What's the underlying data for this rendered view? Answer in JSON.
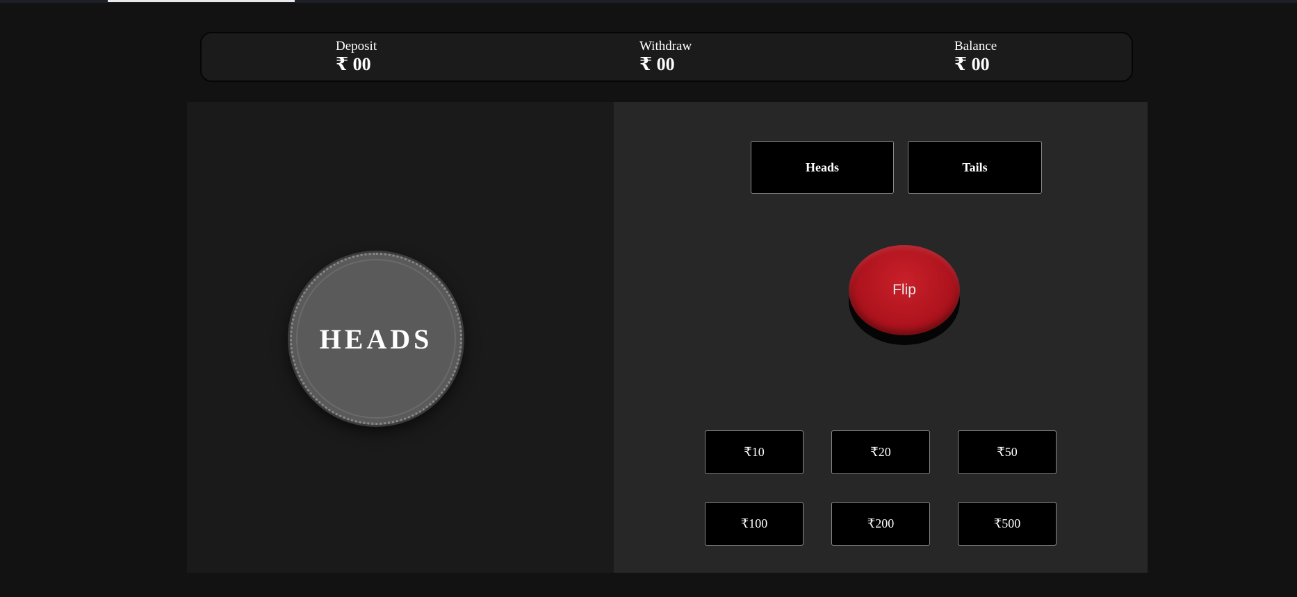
{
  "stats": {
    "deposit": {
      "label": "Deposit",
      "value": "₹ 00"
    },
    "withdraw": {
      "label": "Withdraw",
      "value": "₹ 00"
    },
    "balance": {
      "label": "Balance",
      "value": "₹ 00"
    }
  },
  "coin": {
    "face": "HEADS"
  },
  "choices": {
    "heads_label": "Heads",
    "tails_label": "Tails"
  },
  "flip": {
    "label": "Flip",
    "color": "#b0141e"
  },
  "amounts": [
    "₹10",
    "₹20",
    "₹50",
    "₹100",
    "₹200",
    "₹500"
  ]
}
